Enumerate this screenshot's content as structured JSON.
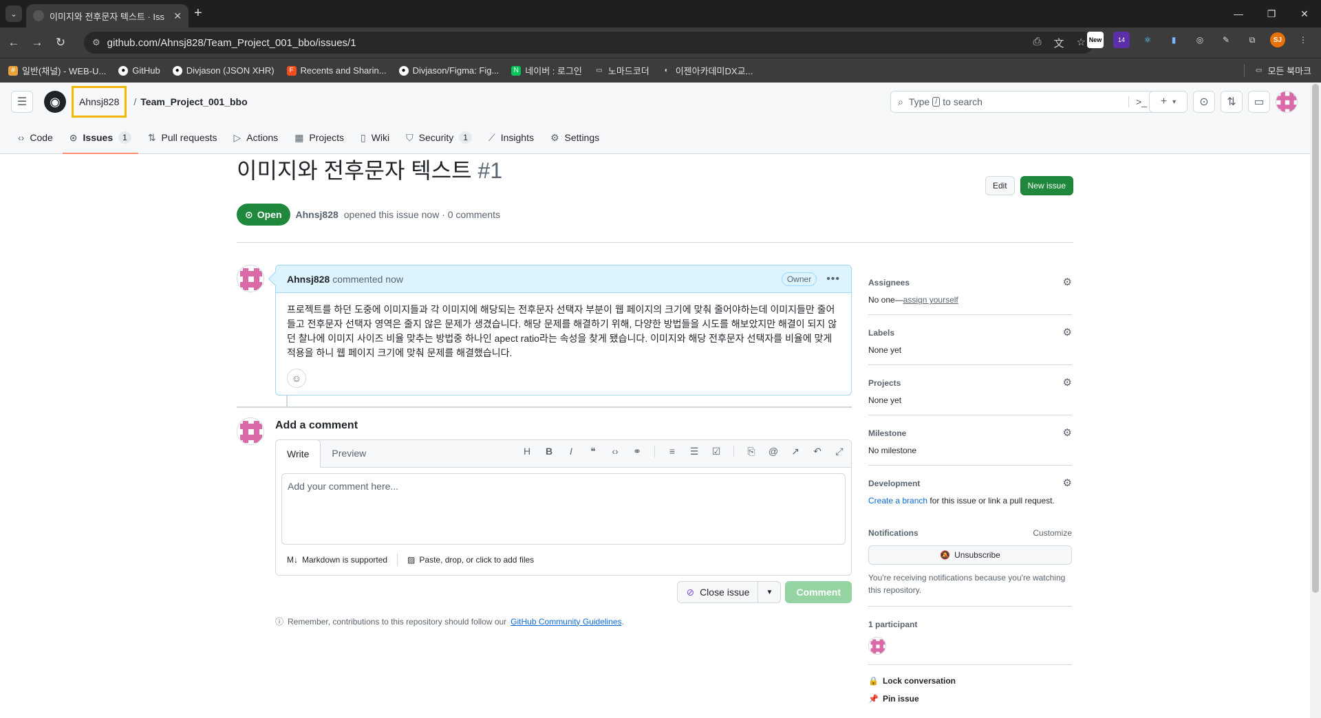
{
  "browser": {
    "tab_title": "이미지와 전후문자 텍스트 · Iss",
    "url": "github.com/Ahnsj828/Team_Project_001_bbo/issues/1",
    "profile_initials": "SJ",
    "ext_badge": "14",
    "ext_new": "New",
    "bookmarks": [
      {
        "label": "일반(채널) - WEB-U...",
        "icon": "#"
      },
      {
        "label": "GitHub",
        "icon": "●"
      },
      {
        "label": "Divjason (JSON XHR)",
        "icon": "●"
      },
      {
        "label": "Recents and Sharin...",
        "icon": "F"
      },
      {
        "label": "Divjason/Figma: Fig...",
        "icon": "●"
      },
      {
        "label": "네이버 : 로그인",
        "icon": "N"
      },
      {
        "label": "노마드코더",
        "icon": "▭"
      },
      {
        "label": "이젠아카데미DX교...",
        "icon": "◐"
      }
    ],
    "all_bookmarks": "모든 북마크"
  },
  "header": {
    "owner": "Ahnsj828",
    "repo": "Team_Project_001_bbo",
    "search_pre": "Type",
    "search_key": "/",
    "search_post": "to search"
  },
  "repo_nav": [
    {
      "label": "Code",
      "icon": "‹›",
      "count": ""
    },
    {
      "label": "Issues",
      "icon": "⊙",
      "count": "1"
    },
    {
      "label": "Pull requests",
      "icon": "⇅",
      "count": ""
    },
    {
      "label": "Actions",
      "icon": "▷",
      "count": ""
    },
    {
      "label": "Projects",
      "icon": "▦",
      "count": ""
    },
    {
      "label": "Wiki",
      "icon": "▯",
      "count": ""
    },
    {
      "label": "Security",
      "icon": "⛉",
      "count": "1"
    },
    {
      "label": "Insights",
      "icon": "⟋",
      "count": ""
    },
    {
      "label": "Settings",
      "icon": "⚙",
      "count": ""
    }
  ],
  "issue": {
    "title": "이미지와 전후문자 텍스트",
    "number": "#1",
    "edit_label": "Edit",
    "new_issue_label": "New issue",
    "state": "Open",
    "author": "Ahnsj828",
    "meta": "opened this issue now · 0 comments"
  },
  "comment": {
    "author": "Ahnsj828",
    "when": "commented now",
    "role": "Owner",
    "body": "프로젝트를 하던 도중에 이미지들과 각 이미지에 해당되는 전후문자 선택자 부분이 웹 페이지의 크기에 맞춰 줄어야하는데 이미지들만 줄어들고 전후문자 선택자 영역은 줄지 않은 문제가 생겼습니다. 해당 문제를 해결하기 위해, 다양한 방법들을 시도를 해보았지만 해결이 되지 않던 찰나에 이미지 사이즈 비율 맞추는 방법중 하나인 apect ratio라는 속성을 찾게 됐습니다. 이미지와 해당 전후문자 선택자를 비율에 맞게 적용을 하니 웹 페이지 크기에 맞춰 문제를 해결했습니다."
  },
  "add_comment": {
    "title": "Add a comment",
    "tab_write": "Write",
    "tab_preview": "Preview",
    "placeholder": "Add your comment here...",
    "markdown": "Markdown is supported",
    "files": "Paste, drop, or click to add files",
    "close_issue": "Close issue",
    "comment_btn": "Comment",
    "guide_pre": "Remember, contributions to this repository should follow our",
    "guide_link": "GitHub Community Guidelines",
    "guide_post": "."
  },
  "sidebar": {
    "assignees_label": "Assignees",
    "assignees_val": "No one—",
    "assign_yourself": "assign yourself",
    "labels_label": "Labels",
    "labels_val": "None yet",
    "projects_label": "Projects",
    "projects_val": "None yet",
    "milestone_label": "Milestone",
    "milestone_val": "No milestone",
    "development_label": "Development",
    "create_branch": "Create a branch",
    "development_rest": "for this issue or link a pull request.",
    "notifications_label": "Notifications",
    "customize": "Customize",
    "unsubscribe": "Unsubscribe",
    "notif_note": "You're receiving notifications because you're watching this repository.",
    "participants": "1 participant",
    "lock": "Lock conversation",
    "pin": "Pin issue"
  }
}
